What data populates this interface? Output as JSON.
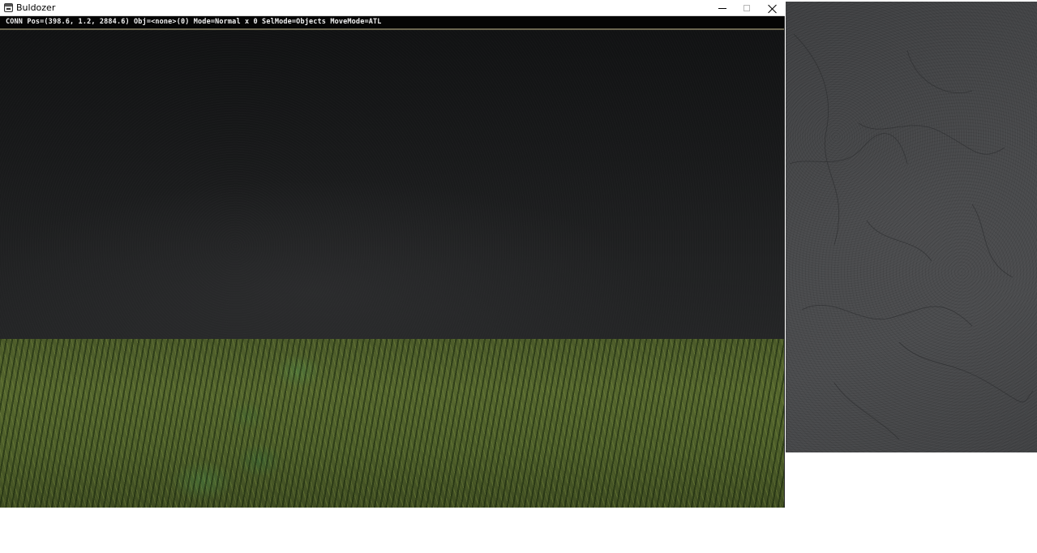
{
  "window": {
    "title": "Buldozer",
    "controls": {
      "minimize_icon": "minimize-icon",
      "maximize_icon": "maximize-icon",
      "close_icon": "close-icon"
    }
  },
  "statusbar": {
    "text": "CONN Pos=(398.6, 1.2, 2884.6) Obj=<none>(0) Mode=Normal x 0 SelMode=Objects MoveMode=ATL"
  },
  "viewport": {
    "ground_materials": [
      "asphalt",
      "grass"
    ]
  },
  "texture_preview": {
    "material": "asphalt"
  },
  "colors": {
    "titlebar": "#ffffff",
    "statusbar": "#050505",
    "statusbar_text": "#f2f2f2",
    "asphalt": "#1c1d1e",
    "grass": "#4f602c",
    "texture_panel": "#46474a"
  }
}
